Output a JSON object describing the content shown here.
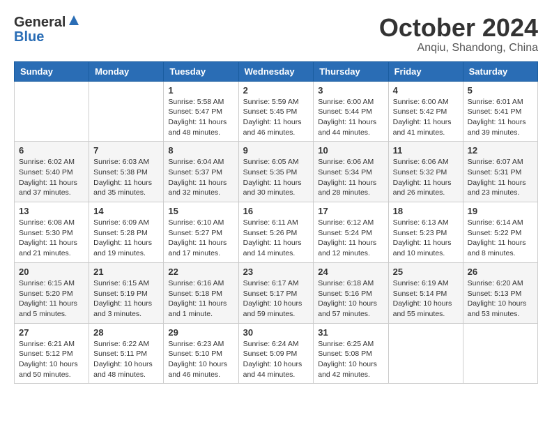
{
  "logo": {
    "general": "General",
    "blue": "Blue"
  },
  "header": {
    "month": "October 2024",
    "location": "Anqiu, Shandong, China"
  },
  "weekdays": [
    "Sunday",
    "Monday",
    "Tuesday",
    "Wednesday",
    "Thursday",
    "Friday",
    "Saturday"
  ],
  "weeks": [
    [
      {
        "day": "",
        "sunrise": "",
        "sunset": "",
        "daylight": ""
      },
      {
        "day": "",
        "sunrise": "",
        "sunset": "",
        "daylight": ""
      },
      {
        "day": "1",
        "sunrise": "Sunrise: 5:58 AM",
        "sunset": "Sunset: 5:47 PM",
        "daylight": "Daylight: 11 hours and 48 minutes."
      },
      {
        "day": "2",
        "sunrise": "Sunrise: 5:59 AM",
        "sunset": "Sunset: 5:45 PM",
        "daylight": "Daylight: 11 hours and 46 minutes."
      },
      {
        "day": "3",
        "sunrise": "Sunrise: 6:00 AM",
        "sunset": "Sunset: 5:44 PM",
        "daylight": "Daylight: 11 hours and 44 minutes."
      },
      {
        "day": "4",
        "sunrise": "Sunrise: 6:00 AM",
        "sunset": "Sunset: 5:42 PM",
        "daylight": "Daylight: 11 hours and 41 minutes."
      },
      {
        "day": "5",
        "sunrise": "Sunrise: 6:01 AM",
        "sunset": "Sunset: 5:41 PM",
        "daylight": "Daylight: 11 hours and 39 minutes."
      }
    ],
    [
      {
        "day": "6",
        "sunrise": "Sunrise: 6:02 AM",
        "sunset": "Sunset: 5:40 PM",
        "daylight": "Daylight: 11 hours and 37 minutes."
      },
      {
        "day": "7",
        "sunrise": "Sunrise: 6:03 AM",
        "sunset": "Sunset: 5:38 PM",
        "daylight": "Daylight: 11 hours and 35 minutes."
      },
      {
        "day": "8",
        "sunrise": "Sunrise: 6:04 AM",
        "sunset": "Sunset: 5:37 PM",
        "daylight": "Daylight: 11 hours and 32 minutes."
      },
      {
        "day": "9",
        "sunrise": "Sunrise: 6:05 AM",
        "sunset": "Sunset: 5:35 PM",
        "daylight": "Daylight: 11 hours and 30 minutes."
      },
      {
        "day": "10",
        "sunrise": "Sunrise: 6:06 AM",
        "sunset": "Sunset: 5:34 PM",
        "daylight": "Daylight: 11 hours and 28 minutes."
      },
      {
        "day": "11",
        "sunrise": "Sunrise: 6:06 AM",
        "sunset": "Sunset: 5:32 PM",
        "daylight": "Daylight: 11 hours and 26 minutes."
      },
      {
        "day": "12",
        "sunrise": "Sunrise: 6:07 AM",
        "sunset": "Sunset: 5:31 PM",
        "daylight": "Daylight: 11 hours and 23 minutes."
      }
    ],
    [
      {
        "day": "13",
        "sunrise": "Sunrise: 6:08 AM",
        "sunset": "Sunset: 5:30 PM",
        "daylight": "Daylight: 11 hours and 21 minutes."
      },
      {
        "day": "14",
        "sunrise": "Sunrise: 6:09 AM",
        "sunset": "Sunset: 5:28 PM",
        "daylight": "Daylight: 11 hours and 19 minutes."
      },
      {
        "day": "15",
        "sunrise": "Sunrise: 6:10 AM",
        "sunset": "Sunset: 5:27 PM",
        "daylight": "Daylight: 11 hours and 17 minutes."
      },
      {
        "day": "16",
        "sunrise": "Sunrise: 6:11 AM",
        "sunset": "Sunset: 5:26 PM",
        "daylight": "Daylight: 11 hours and 14 minutes."
      },
      {
        "day": "17",
        "sunrise": "Sunrise: 6:12 AM",
        "sunset": "Sunset: 5:24 PM",
        "daylight": "Daylight: 11 hours and 12 minutes."
      },
      {
        "day": "18",
        "sunrise": "Sunrise: 6:13 AM",
        "sunset": "Sunset: 5:23 PM",
        "daylight": "Daylight: 11 hours and 10 minutes."
      },
      {
        "day": "19",
        "sunrise": "Sunrise: 6:14 AM",
        "sunset": "Sunset: 5:22 PM",
        "daylight": "Daylight: 11 hours and 8 minutes."
      }
    ],
    [
      {
        "day": "20",
        "sunrise": "Sunrise: 6:15 AM",
        "sunset": "Sunset: 5:20 PM",
        "daylight": "Daylight: 11 hours and 5 minutes."
      },
      {
        "day": "21",
        "sunrise": "Sunrise: 6:15 AM",
        "sunset": "Sunset: 5:19 PM",
        "daylight": "Daylight: 11 hours and 3 minutes."
      },
      {
        "day": "22",
        "sunrise": "Sunrise: 6:16 AM",
        "sunset": "Sunset: 5:18 PM",
        "daylight": "Daylight: 11 hours and 1 minute."
      },
      {
        "day": "23",
        "sunrise": "Sunrise: 6:17 AM",
        "sunset": "Sunset: 5:17 PM",
        "daylight": "Daylight: 10 hours and 59 minutes."
      },
      {
        "day": "24",
        "sunrise": "Sunrise: 6:18 AM",
        "sunset": "Sunset: 5:16 PM",
        "daylight": "Daylight: 10 hours and 57 minutes."
      },
      {
        "day": "25",
        "sunrise": "Sunrise: 6:19 AM",
        "sunset": "Sunset: 5:14 PM",
        "daylight": "Daylight: 10 hours and 55 minutes."
      },
      {
        "day": "26",
        "sunrise": "Sunrise: 6:20 AM",
        "sunset": "Sunset: 5:13 PM",
        "daylight": "Daylight: 10 hours and 53 minutes."
      }
    ],
    [
      {
        "day": "27",
        "sunrise": "Sunrise: 6:21 AM",
        "sunset": "Sunset: 5:12 PM",
        "daylight": "Daylight: 10 hours and 50 minutes."
      },
      {
        "day": "28",
        "sunrise": "Sunrise: 6:22 AM",
        "sunset": "Sunset: 5:11 PM",
        "daylight": "Daylight: 10 hours and 48 minutes."
      },
      {
        "day": "29",
        "sunrise": "Sunrise: 6:23 AM",
        "sunset": "Sunset: 5:10 PM",
        "daylight": "Daylight: 10 hours and 46 minutes."
      },
      {
        "day": "30",
        "sunrise": "Sunrise: 6:24 AM",
        "sunset": "Sunset: 5:09 PM",
        "daylight": "Daylight: 10 hours and 44 minutes."
      },
      {
        "day": "31",
        "sunrise": "Sunrise: 6:25 AM",
        "sunset": "Sunset: 5:08 PM",
        "daylight": "Daylight: 10 hours and 42 minutes."
      },
      {
        "day": "",
        "sunrise": "",
        "sunset": "",
        "daylight": ""
      },
      {
        "day": "",
        "sunrise": "",
        "sunset": "",
        "daylight": ""
      }
    ]
  ]
}
